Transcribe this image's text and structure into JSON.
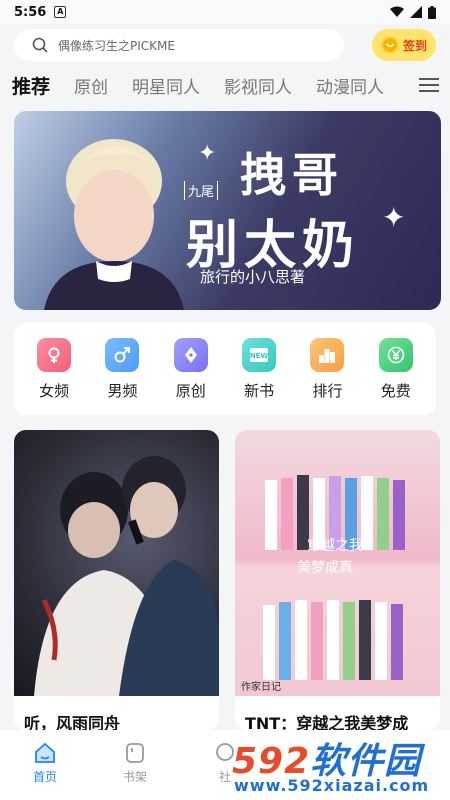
{
  "status_bar": {
    "time": "5:56",
    "notif": "A"
  },
  "search": {
    "placeholder": "偶像练习生之PICKME"
  },
  "signin": {
    "label": "签到"
  },
  "tabs": [
    {
      "label": "推荐",
      "active": true
    },
    {
      "label": "原创"
    },
    {
      "label": "明星同人"
    },
    {
      "label": "影视同人"
    },
    {
      "label": "动漫同人"
    }
  ],
  "banner": {
    "tag": "九尾",
    "line1": "拽哥",
    "line2": "别太奶",
    "author": "旅行的小八思著"
  },
  "categories": [
    {
      "label": "女频",
      "icon": "female-icon",
      "color": "#f0607a"
    },
    {
      "label": "男频",
      "icon": "male-icon",
      "color": "#4b9cf5"
    },
    {
      "label": "原创",
      "icon": "pen-nib-icon",
      "color": "#7a74f0"
    },
    {
      "label": "新书",
      "icon": "new-book-icon",
      "color": "#37c7c0"
    },
    {
      "label": "排行",
      "icon": "ranking-icon",
      "color": "#f7a03c"
    },
    {
      "label": "免费",
      "icon": "yuan-icon",
      "color": "#36c46b"
    }
  ],
  "books": [
    {
      "title": "听，风雨同舟"
    },
    {
      "title": "TNT：穿越之我美梦成",
      "cover_text_top": "穿越之我",
      "cover_text_bottom": "美梦成真",
      "cover_caption": "作家日记"
    }
  ],
  "bottom_nav": [
    {
      "label": "首页",
      "icon": "home-icon",
      "active": true
    },
    {
      "label": "书架",
      "icon": "bookshelf-icon"
    },
    {
      "label": "社",
      "icon": "community-icon"
    }
  ],
  "watermark": {
    "brand_num": "592",
    "brand_text": "软件园",
    "url": "www.592xiazai.com"
  },
  "colors": {
    "accent": "#1f86ff",
    "signin_bg": "#ffe36a",
    "page_bg": "#f4f5f7"
  }
}
